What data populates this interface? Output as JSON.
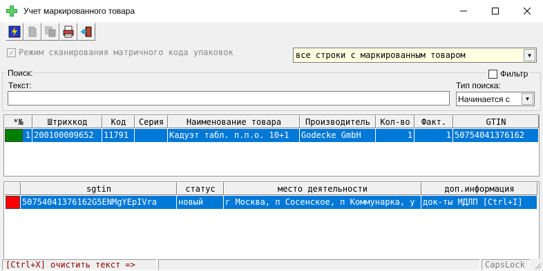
{
  "window": {
    "title": "Учет маркированного товара",
    "minimize_icon": "minimize-icon",
    "maximize_icon": "maximize-icon",
    "close_icon": "close-icon"
  },
  "toolbar": {
    "buttons": [
      {
        "icon": "lightning-icon"
      },
      {
        "icon": "document-icon"
      },
      {
        "icon": "copy-icon"
      },
      {
        "icon": "printer-icon"
      },
      {
        "icon": "exit-door-icon"
      }
    ]
  },
  "scan_mode": {
    "label": "Режим сканирования матричного кода упаковок",
    "checked": true,
    "disabled": true
  },
  "row_filter": {
    "value": "все строки с маркированным товаром"
  },
  "search": {
    "group_label": "Поиск:",
    "filter_label": "Фильтр",
    "filter_checked": false,
    "text_label": "Текст:",
    "text_value": "",
    "type_label": "Тип поиска:",
    "type_value": "Начинается с"
  },
  "goods_table": {
    "columns": [
      "*№",
      "Штрихкод",
      "Код",
      "Серия",
      "Наименование товара",
      "Производитель",
      "Кол-во",
      "Факт.",
      "GTIN"
    ],
    "rows": [
      {
        "cells": [
          "1",
          "200100009652",
          "11791",
          "",
          "Кадуэт табл. п.п.о. 10+1",
          "Godecke GmbH",
          "1",
          "1",
          "50754041376162"
        ],
        "marker_color": "#008000"
      }
    ]
  },
  "sgtin_table": {
    "columns": [
      "sgtin",
      "статус",
      "место деятельности",
      "доп.информация"
    ],
    "rows": [
      {
        "cells": [
          "50754041376162G5ENMgYEpIVra",
          "новый",
          "г Москва, п Сосенское, п Коммунарка, у",
          "док-ты МДЛП [Ctrl+I]"
        ],
        "marker_color": "#ff0000"
      }
    ]
  },
  "statusbar": {
    "hint": "[Ctrl+X] очистить текст =>",
    "middle": "",
    "caps": "CapsLock"
  },
  "colors": {
    "selection": "#0078d7",
    "filter_background": "#ffffe1",
    "hint_text": "#8b0000"
  }
}
